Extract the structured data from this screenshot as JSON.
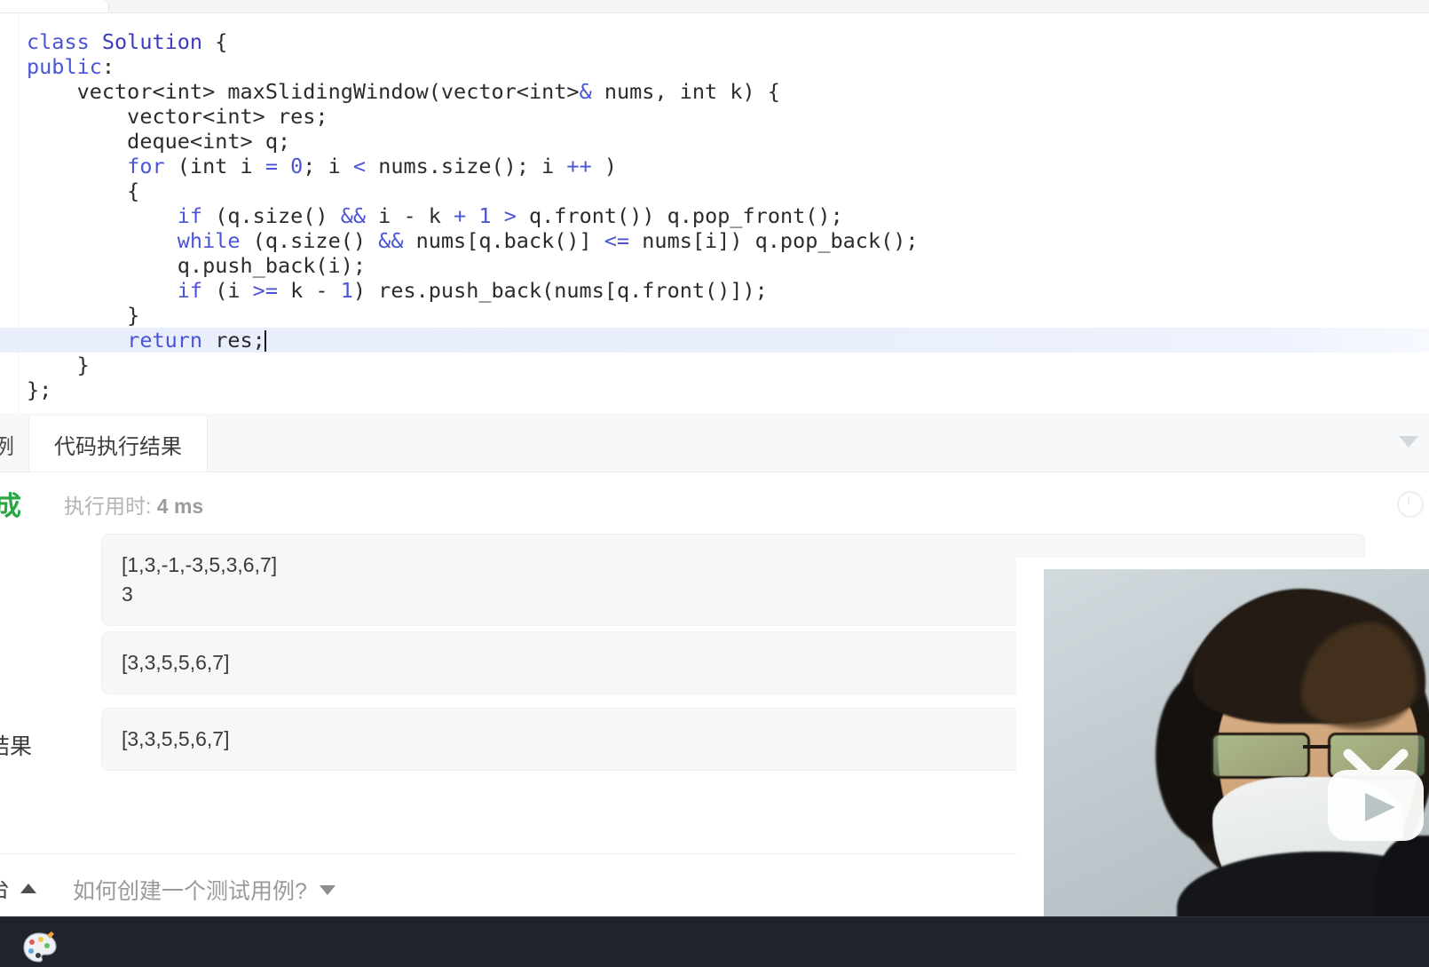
{
  "editor": {
    "language": "C++",
    "lines": [
      [
        {
          "t": "class ",
          "c": "kw"
        },
        {
          "t": "Solution",
          "c": "type-t"
        },
        {
          "t": " {",
          "c": "plain"
        }
      ],
      [
        {
          "t": "public",
          "c": "kw"
        },
        {
          "t": ":",
          "c": "plain"
        }
      ],
      [
        {
          "t": "    vector<",
          "c": "plain"
        },
        {
          "t": "int",
          "c": "plain"
        },
        {
          "t": "> maxSlidingWindow(vector<",
          "c": "plain"
        },
        {
          "t": "int",
          "c": "plain"
        },
        {
          "t": ">",
          "c": "plain"
        },
        {
          "t": "&",
          "c": "op"
        },
        {
          "t": " nums, int k) {",
          "c": "plain"
        }
      ],
      [
        {
          "t": "        vector<int> res;",
          "c": "plain"
        }
      ],
      [
        {
          "t": "        deque<int> q;",
          "c": "plain"
        }
      ],
      [
        {
          "t": "        ",
          "c": "plain"
        },
        {
          "t": "for",
          "c": "kw"
        },
        {
          "t": " (int i ",
          "c": "plain"
        },
        {
          "t": "=",
          "c": "op"
        },
        {
          "t": " ",
          "c": "plain"
        },
        {
          "t": "0",
          "c": "num"
        },
        {
          "t": "; i ",
          "c": "plain"
        },
        {
          "t": "<",
          "c": "op"
        },
        {
          "t": " nums.size(); i ",
          "c": "plain"
        },
        {
          "t": "++",
          "c": "op"
        },
        {
          "t": " )",
          "c": "plain"
        }
      ],
      [
        {
          "t": "        {",
          "c": "plain"
        }
      ],
      [
        {
          "t": "            ",
          "c": "plain"
        },
        {
          "t": "if",
          "c": "kw"
        },
        {
          "t": " (q.size() ",
          "c": "plain"
        },
        {
          "t": "&&",
          "c": "op"
        },
        {
          "t": " i ",
          "c": "plain"
        },
        {
          "t": "-",
          "c": "plain"
        },
        {
          "t": " k ",
          "c": "plain"
        },
        {
          "t": "+",
          "c": "op"
        },
        {
          "t": " ",
          "c": "plain"
        },
        {
          "t": "1",
          "c": "num"
        },
        {
          "t": " ",
          "c": "plain"
        },
        {
          "t": ">",
          "c": "op"
        },
        {
          "t": " q.front()) q.pop_front();",
          "c": "plain"
        }
      ],
      [
        {
          "t": "            ",
          "c": "plain"
        },
        {
          "t": "while",
          "c": "kw"
        },
        {
          "t": " (q.size() ",
          "c": "plain"
        },
        {
          "t": "&&",
          "c": "op"
        },
        {
          "t": " nums[q.back()] ",
          "c": "plain"
        },
        {
          "t": "<=",
          "c": "op"
        },
        {
          "t": " nums[i]) q.pop_back();",
          "c": "plain"
        }
      ],
      [
        {
          "t": "            q.push_back(i);",
          "c": "plain"
        }
      ],
      [
        {
          "t": "            ",
          "c": "plain"
        },
        {
          "t": "if",
          "c": "kw"
        },
        {
          "t": " (i ",
          "c": "plain"
        },
        {
          "t": ">=",
          "c": "op"
        },
        {
          "t": " k ",
          "c": "plain"
        },
        {
          "t": "-",
          "c": "plain"
        },
        {
          "t": " ",
          "c": "plain"
        },
        {
          "t": "1",
          "c": "num"
        },
        {
          "t": ") res.push_back(nums[q.front()]);",
          "c": "plain"
        }
      ],
      [
        {
          "t": "        }",
          "c": "plain"
        }
      ],
      [
        {
          "t": "        ",
          "c": "plain"
        },
        {
          "t": "return",
          "c": "kw"
        },
        {
          "t": " res;",
          "c": "plain"
        }
      ],
      [
        {
          "t": "    }",
          "c": "plain"
        }
      ],
      [
        {
          "t": "};",
          "c": "plain"
        }
      ]
    ],
    "active_line_index": 12,
    "cursor_after": "return res;"
  },
  "result_panel": {
    "tabs": [
      {
        "label": "例",
        "active": false,
        "truncated": true
      },
      {
        "label": "代码执行结果",
        "active": true,
        "truncated": false
      }
    ],
    "collapse_icon": "chevron-down-icon",
    "status": {
      "verdict": "成",
      "verdict_color": "#2aa745",
      "runtime_label": "执行用时:",
      "runtime_value": "4 ms",
      "info_icon": "info-circle-icon"
    },
    "io_rows": [
      {
        "label": "",
        "value": "[1,3,-1,-3,5,3,6,7]\n3"
      },
      {
        "label": "",
        "value": "[3,3,5,5,6,7]"
      },
      {
        "label": "结果",
        "value": "[3,3,5,5,6,7]"
      }
    ]
  },
  "console_bar": {
    "console_label": "台",
    "console_caret": "caret-up-icon",
    "hint_label": "如何创建一个测试用例?",
    "hint_caret": "caret-down-icon"
  },
  "webcam": {
    "watermark": "bilibili-tv-logo",
    "subject": "person-with-mask-and-glasses"
  },
  "taskbar": {
    "icons": [
      "paint-palette-icon"
    ],
    "background": "#20232a"
  }
}
